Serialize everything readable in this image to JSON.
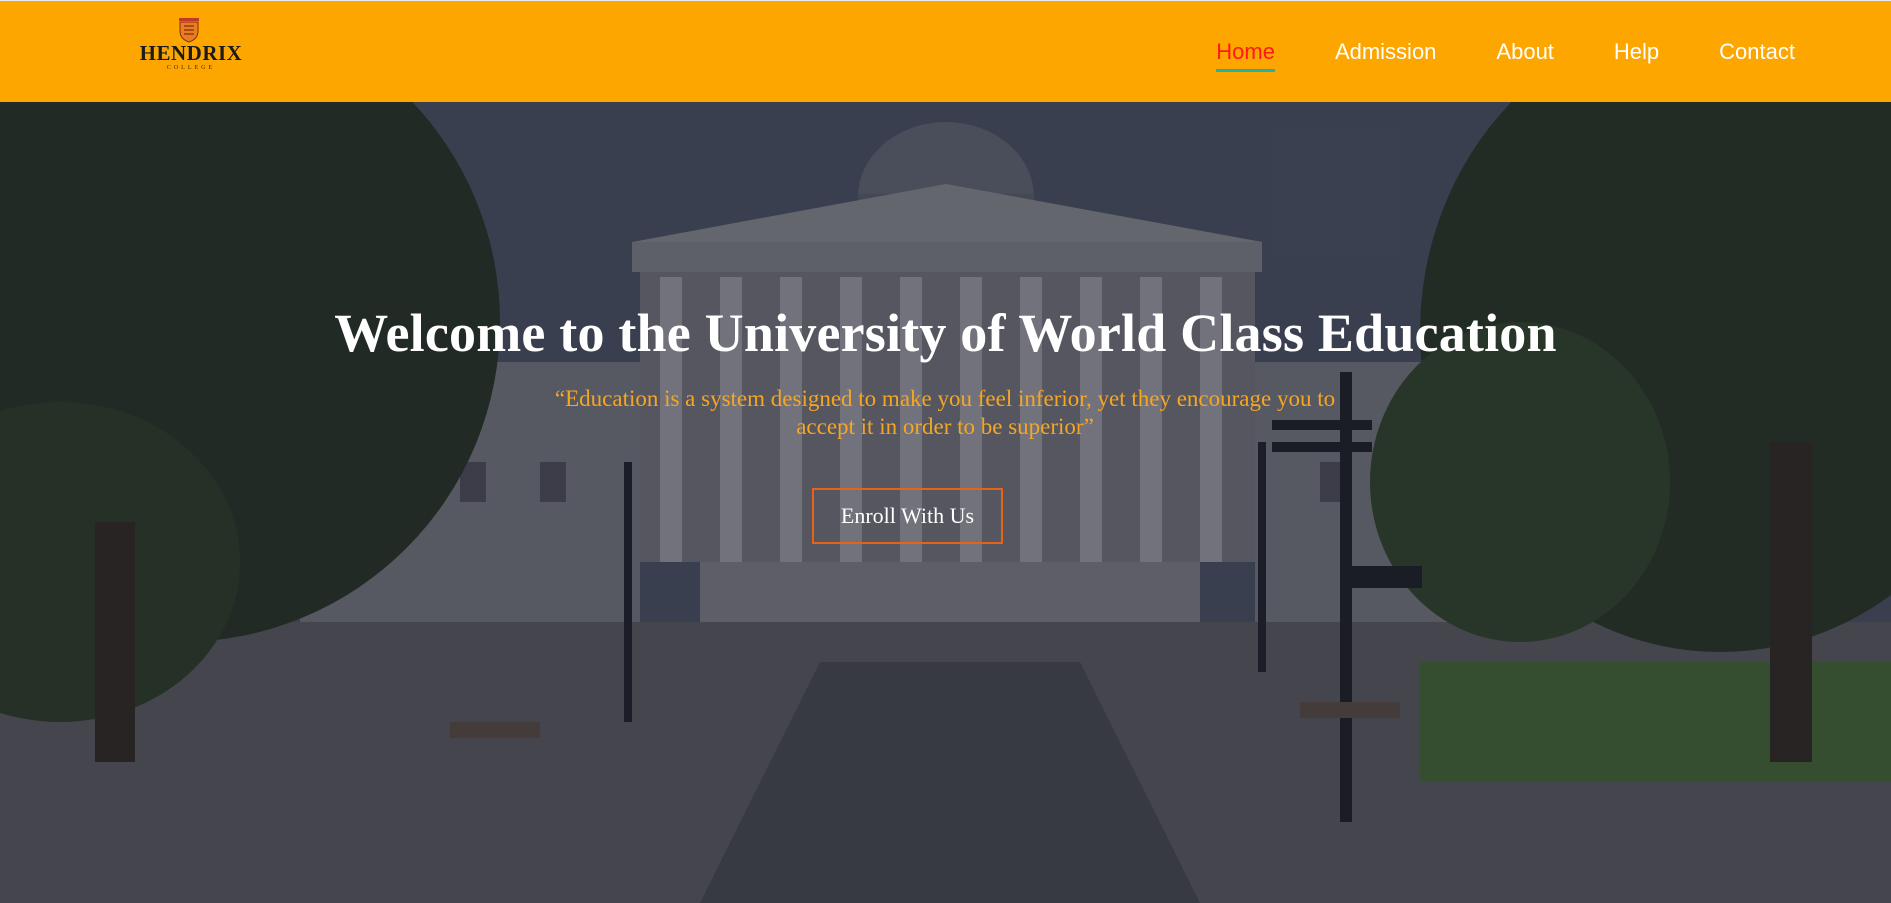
{
  "header": {
    "logo": {
      "name": "HENDRIX",
      "subtitle": "COLLEGE"
    },
    "nav": [
      {
        "label": "Home",
        "active": true
      },
      {
        "label": "Admission",
        "active": false
      },
      {
        "label": "About",
        "active": false
      },
      {
        "label": "Help",
        "active": false
      },
      {
        "label": "Contact",
        "active": false
      }
    ]
  },
  "hero": {
    "title": "Welcome to the University of World Class Education",
    "quote": "“Education is a system designed to make you feel inferior, yet they encourage you to accept it in order to be superior”",
    "cta_label": "Enroll With Us",
    "background_icon": "university-building-photo"
  },
  "colors": {
    "header_bg": "#fea600",
    "nav_text": "#ffffff",
    "nav_active": "#ff1a1a",
    "nav_active_underline": "#20b2aa",
    "quote_text": "#f5a623",
    "cta_border": "#e8631a"
  }
}
